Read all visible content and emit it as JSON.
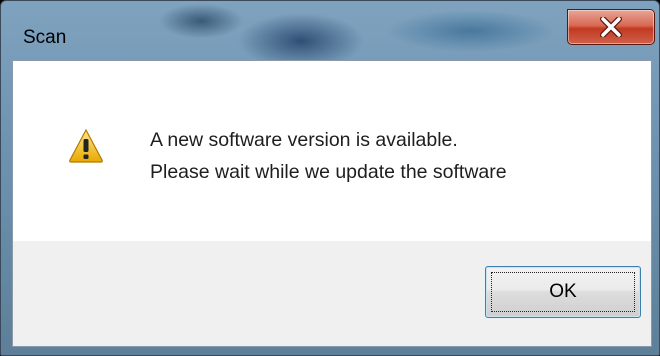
{
  "window": {
    "title": "Scan",
    "close_icon": "close-x-icon",
    "colors": {
      "close_button": "#c8452d",
      "content_background": "#ffffff",
      "footer_background": "#f0f0f0"
    }
  },
  "dialog": {
    "icon": "warning-icon",
    "message_line1": "A new software version is available.",
    "message_line2": "Please wait while we update the software",
    "ok_label": "OK"
  }
}
